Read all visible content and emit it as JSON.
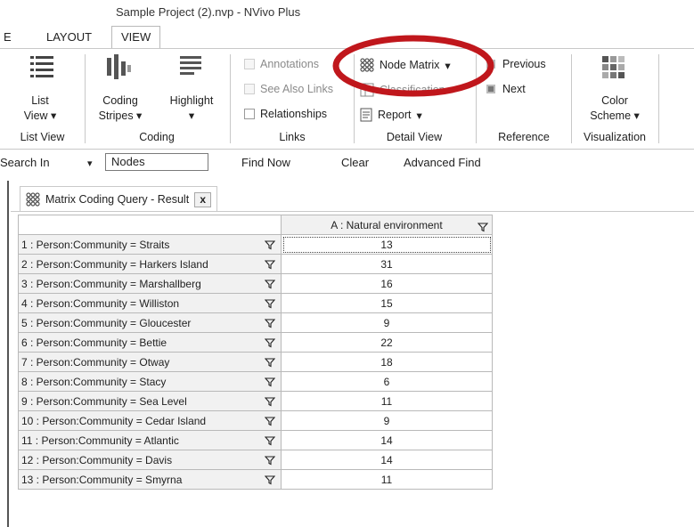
{
  "window": {
    "title": "Sample Project (2).nvp - NVivo Plus"
  },
  "tabs": [
    {
      "label": "E"
    },
    {
      "label": "LAYOUT"
    },
    {
      "label": "VIEW"
    }
  ],
  "ribbon": {
    "list_view": {
      "line1": "List",
      "line2": "View ▾",
      "group": "List View"
    },
    "coding": {
      "stripes1": "Coding",
      "stripes2": "Stripes ▾",
      "highlight": "Highlight",
      "highlight_arrow": "▾",
      "group": "Coding"
    },
    "links": {
      "annotations": "Annotations",
      "see_also": "See Also Links",
      "relationships": "Relationships",
      "group": "Links"
    },
    "detail_view": {
      "node_matrix": "Node Matrix",
      "node_matrix_arrow": "▾",
      "classification": "Classification",
      "report": "Report",
      "report_arrow": "▾",
      "group": "Detail View"
    },
    "reference": {
      "previous": "Previous",
      "next": "Next",
      "group": "Reference"
    },
    "visualization": {
      "line1": "Color",
      "line2": "Scheme ▾",
      "group": "Visualization"
    },
    "highlight_ring_color": "#c0171c"
  },
  "search": {
    "search_in": "Search In",
    "dropdown_arrow": "▾",
    "field_value": "Nodes",
    "find_now": "Find Now",
    "clear": "Clear",
    "advanced_find": "Advanced Find"
  },
  "document": {
    "tab_label": "Matrix Coding Query - Result",
    "close_label": "x"
  },
  "matrix": {
    "column_header": "A : Natural environment",
    "rows": [
      {
        "label": "1 : Person:Community = Straits",
        "value": "13"
      },
      {
        "label": "2 : Person:Community = Harkers Island",
        "value": "31"
      },
      {
        "label": "3 : Person:Community = Marshallberg",
        "value": "16"
      },
      {
        "label": "4 : Person:Community = Williston",
        "value": "15"
      },
      {
        "label": "5 : Person:Community = Gloucester",
        "value": "9"
      },
      {
        "label": "6 : Person:Community = Bettie",
        "value": "22"
      },
      {
        "label": "7 : Person:Community = Otway",
        "value": "18"
      },
      {
        "label": "8 : Person:Community = Stacy",
        "value": "6"
      },
      {
        "label": "9 : Person:Community = Sea Level",
        "value": "11"
      },
      {
        "label": "10 : Person:Community = Cedar Island",
        "value": "9"
      },
      {
        "label": "11 : Person:Community = Atlantic",
        "value": "14"
      },
      {
        "label": "12 : Person:Community = Davis",
        "value": "14"
      },
      {
        "label": "13 : Person:Community = Smyrna",
        "value": "11"
      }
    ]
  }
}
